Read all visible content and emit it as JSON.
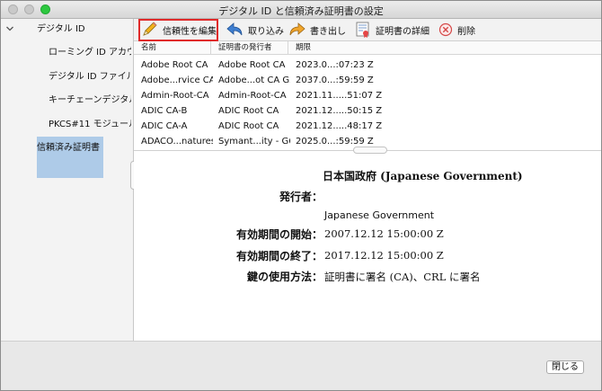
{
  "window": {
    "title": "デジタル ID と信頼済み証明書の設定"
  },
  "sidebar": {
    "items": [
      {
        "label": "デジタル ID"
      },
      {
        "label": "ローミング ID アカウ"
      },
      {
        "label": "デジタル ID ファイル"
      },
      {
        "label": "キーチェーンデジタル"
      },
      {
        "label": "PKCS#11 モジュール"
      },
      {
        "label": "信頼済み証明書"
      }
    ]
  },
  "toolbar": {
    "edit_trust": "信頼性を編集",
    "import": "取り込み",
    "export": "書き出し",
    "cert_details": "証明書の詳細",
    "delete": "削除"
  },
  "table": {
    "columns": [
      "名前",
      "証明書の発行者",
      "期限"
    ],
    "rows": [
      [
        "Adobe Root CA",
        "Adobe Root CA",
        "2023.0...:07:23 Z"
      ],
      [
        "Adobe...rvice CA",
        "Adobe...ot CA G2",
        "2037.0...:59:59 Z"
      ],
      [
        "Admin-Root-CA",
        "Admin-Root-CA",
        "2021.11.....51:07 Z"
      ],
      [
        "ADIC CA-B",
        "ADIC Root CA",
        "2021.12.....50:15 Z"
      ],
      [
        "ADIC CA-A",
        "ADIC Root CA",
        "2021.12.....48:17 Z"
      ],
      [
        "ADACO...natures",
        "Symant...ity - G6",
        "2025.0...:59:59 Z"
      ]
    ]
  },
  "detail": {
    "subject": "日本国政府 (Japanese Government)",
    "issuer_label": "発行者：",
    "issuer_value": "Japanese Government",
    "valid_from_label": "有効期間の開始：",
    "valid_from_value": "2007.12.12 15:00:00 Z",
    "valid_to_label": "有効期間の終了：",
    "valid_to_value": "2017.12.12 15:00:00 Z",
    "key_usage_label": "鍵の使用方法：",
    "key_usage_value": "証明書に署名 (CA)、CRL に署名"
  },
  "footer": {
    "close": "閉じる"
  },
  "colors": {
    "highlight": "#e02a2a",
    "selection": "#aecbe8"
  }
}
